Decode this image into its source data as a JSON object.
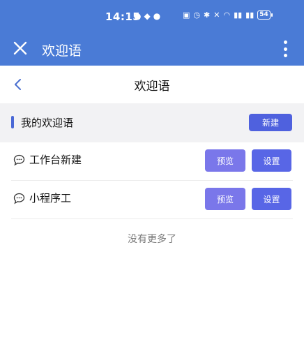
{
  "status_bar": {
    "time": "14:15",
    "battery": "54"
  },
  "title_bar": {
    "title": "欢迎语"
  },
  "page_header": {
    "title": "欢迎语"
  },
  "section": {
    "title": "我的欢迎语",
    "new_label": "新建"
  },
  "items": [
    {
      "label": "工作台新建",
      "preview_label": "预览",
      "settings_label": "设置"
    },
    {
      "label": "小程序工",
      "preview_label": "预览",
      "settings_label": "设置"
    }
  ],
  "footer": {
    "no_more_text": "没有更多了"
  },
  "colors": {
    "header_blue": "#4a7bd6",
    "new_button": "#4f61de",
    "preview_button": "#7a77ea",
    "settings_button": "#5866e6"
  }
}
